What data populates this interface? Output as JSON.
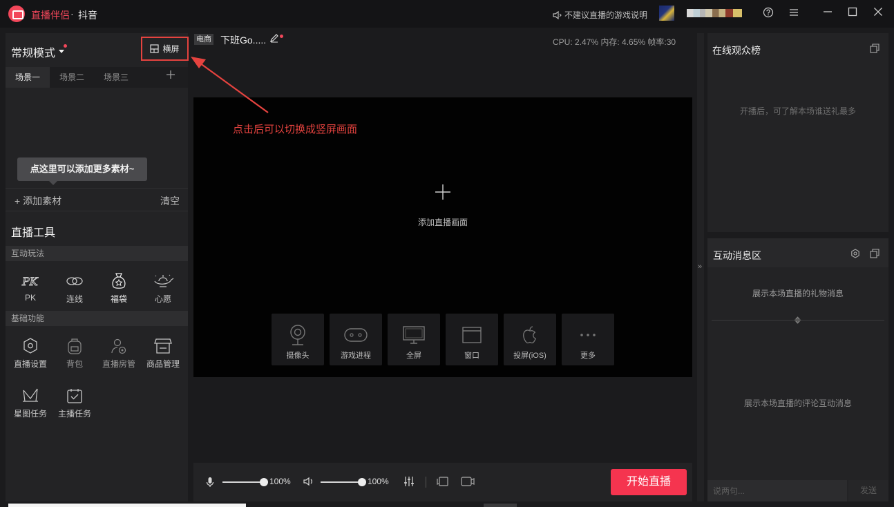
{
  "titlebar": {
    "app_name": "直播伴侣",
    "separator": "·",
    "platform": "抖音",
    "notice": "不建议直播的游戏说明",
    "help_icon": "help-circle-icon",
    "menu_icon": "hamburger-icon",
    "window_controls": [
      "minimize-icon",
      "maximize-icon",
      "close-icon"
    ]
  },
  "left": {
    "mode": "常规模式",
    "orientation_button": "横屏",
    "scenes": [
      "场景一",
      "场景二",
      "场景三"
    ],
    "active_scene": "场景一",
    "material_tip": "点这里可以添加更多素材~",
    "add_material": "+ 添加素材",
    "clear": "清空",
    "tools_title": "直播工具",
    "interactive_section": "互动玩法",
    "interactive_tools": [
      "PK",
      "连线",
      "福袋",
      "心愿"
    ],
    "basic_section": "基础功能",
    "basic_tools": [
      "直播设置",
      "背包",
      "直播房管",
      "商品管理",
      "星图任务",
      "主播任务"
    ]
  },
  "center": {
    "category_tag": "电商",
    "room_title": "下班Go.....",
    "stats": "CPU: 2.47%    内存: 4.65%    帧率:30",
    "annotation": "点击后可以切换成竖屏画面",
    "add_preview": "添加直播画面",
    "sources": [
      "摄像头",
      "游戏进程",
      "全屏",
      "窗口",
      "投屏(iOS)",
      "更多"
    ],
    "mic_volume": "100%",
    "speaker_volume": "100%",
    "mic_level": 1.0,
    "speaker_level": 1.0,
    "start_live": "开始直播"
  },
  "right": {
    "audience_title": "在线观众榜",
    "audience_empty": "开播后，可了解本场谁送礼最多",
    "message_title": "互动消息区",
    "gift_msg": "展示本场直播的礼物消息",
    "comment_msg": "展示本场直播的评论互动消息",
    "chat_placeholder": "说两句...",
    "send": "发送"
  },
  "colors": {
    "accent": "#f5344f",
    "annotation_red": "#e5433f",
    "background": "#1b1b1d",
    "panel": "#232325"
  }
}
